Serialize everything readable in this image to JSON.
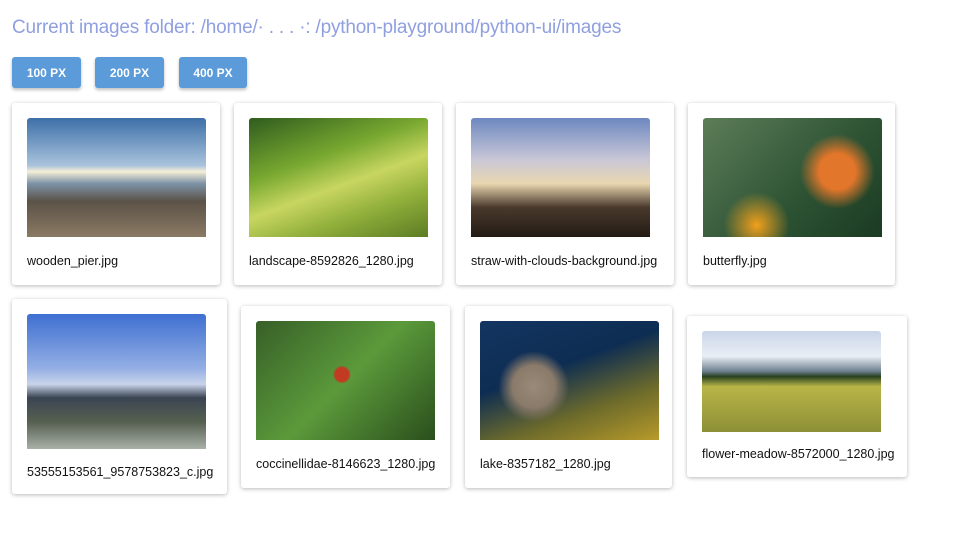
{
  "header": {
    "title": "Current images folder: /home/· . . . ·: /python-playground/python-ui/images"
  },
  "size_buttons": [
    "100 PX",
    "200 PX",
    "400 PX"
  ],
  "images": [
    {
      "filename": "wooden_pier.jpg"
    },
    {
      "filename": "landscape-8592826_1280.jpg"
    },
    {
      "filename": "straw-with-clouds-background.jpg"
    },
    {
      "filename": "butterfly.jpg"
    },
    {
      "filename": "53555153561_9578753823_c.jpg"
    },
    {
      "filename": "coccinellidae-8146623_1280.jpg"
    },
    {
      "filename": "lake-8357182_1280.jpg"
    },
    {
      "filename": "flower-meadow-8572000_1280.jpg"
    }
  ]
}
